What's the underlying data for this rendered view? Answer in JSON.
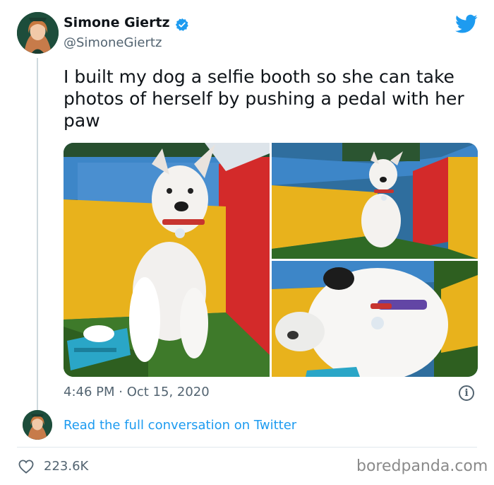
{
  "author": {
    "name": "Simone Giertz",
    "handle": "@SimoneGiertz",
    "verified": true
  },
  "tweet": {
    "text": "I built my dog a selfie booth so she can take photos of herself by pushing a pedal with her paw",
    "timestamp": "4:46 PM · Oct 15, 2020",
    "likes": "223.6K"
  },
  "media": {
    "photo_count": 3
  },
  "conversation": {
    "link_label": "Read the full conversation on Twitter"
  },
  "watermark": "boredpanda.com",
  "colors": {
    "twitter_blue": "#1d9bf0",
    "secondary_text": "#536471",
    "primary_text": "#0f1419"
  },
  "icons": {
    "platform": "twitter-bird-icon",
    "verified": "verified-badge-icon",
    "like": "heart-icon",
    "info": "info-icon"
  }
}
